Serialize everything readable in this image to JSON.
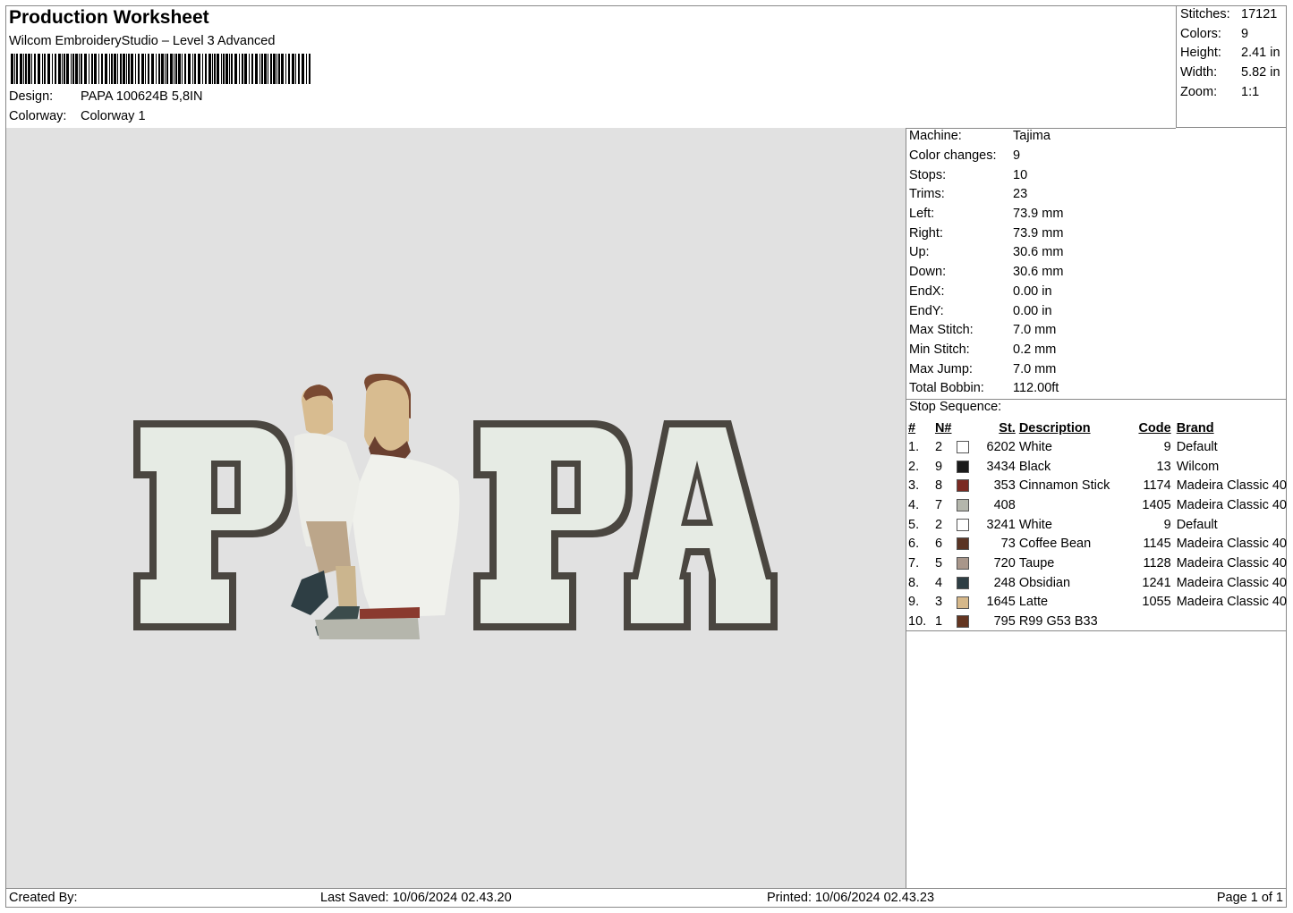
{
  "header": {
    "title": "Production Worksheet",
    "software": "Wilcom EmbroideryStudio – Level 3 Advanced",
    "design_label": "Design:",
    "design_value": "PAPA 100624B 5,8IN",
    "colorway_label": "Colorway:",
    "colorway_value": "Colorway 1"
  },
  "stats": [
    {
      "label": "Stitches:",
      "value": "17121"
    },
    {
      "label": "Colors:",
      "value": "9"
    },
    {
      "label": "Height:",
      "value": "2.41 in"
    },
    {
      "label": "Width:",
      "value": "5.82 in"
    },
    {
      "label": "Zoom:",
      "value": "1:1"
    }
  ],
  "machine_info": [
    {
      "label": "Machine:",
      "value": "Tajima"
    },
    {
      "label": "Color changes:",
      "value": "9"
    },
    {
      "label": "Stops:",
      "value": "10"
    },
    {
      "label": "Trims:",
      "value": "23"
    },
    {
      "label": "Left:",
      "value": "73.9 mm"
    },
    {
      "label": "Right:",
      "value": "73.9 mm"
    },
    {
      "label": "Up:",
      "value": "30.6 mm"
    },
    {
      "label": "Down:",
      "value": "30.6 mm"
    },
    {
      "label": "EndX:",
      "value": "0.00 in"
    },
    {
      "label": "EndY:",
      "value": "0.00 in"
    },
    {
      "label": "Max Stitch:",
      "value": "7.0 mm"
    },
    {
      "label": "Min Stitch:",
      "value": "0.2 mm"
    },
    {
      "label": "Max Jump:",
      "value": "7.0 mm"
    },
    {
      "label": "Total Bobbin:",
      "value": "112.00ft"
    }
  ],
  "stop_sequence": {
    "title": "Stop Sequence:",
    "columns": [
      "#",
      "N#",
      "St.",
      "Description",
      "Code",
      "Brand"
    ],
    "rows": [
      {
        "num": "1.",
        "n": "2",
        "color": "#ffffff",
        "st": "6202",
        "desc": "White",
        "code": "9",
        "brand": "Default"
      },
      {
        "num": "2.",
        "n": "9",
        "color": "#1a1a1a",
        "st": "3434",
        "desc": "Black",
        "code": "13",
        "brand": "Wilcom"
      },
      {
        "num": "3.",
        "n": "8",
        "color": "#7a2a22",
        "st": "353",
        "desc": "Cinnamon Stick",
        "code": "1174",
        "brand": "Madeira Classic 40"
      },
      {
        "num": "4.",
        "n": "7",
        "color": "#b4b6ac",
        "st": "408",
        "desc": "",
        "code": "1405",
        "brand": "Madeira Classic 40"
      },
      {
        "num": "5.",
        "n": "2",
        "color": "#ffffff",
        "st": "3241",
        "desc": "White",
        "code": "9",
        "brand": "Default"
      },
      {
        "num": "6.",
        "n": "6",
        "color": "#5a3424",
        "st": "73",
        "desc": "Coffee Bean",
        "code": "1145",
        "brand": "Madeira Classic 40"
      },
      {
        "num": "7.",
        "n": "5",
        "color": "#a8968a",
        "st": "720",
        "desc": "Taupe",
        "code": "1128",
        "brand": "Madeira Classic 40"
      },
      {
        "num": "8.",
        "n": "4",
        "color": "#2e3e44",
        "st": "248",
        "desc": "Obsidian",
        "code": "1241",
        "brand": "Madeira Classic 40"
      },
      {
        "num": "9.",
        "n": "3",
        "color": "#d6b88a",
        "st": "1645",
        "desc": "Latte",
        "code": "1055",
        "brand": "Madeira Classic 40"
      },
      {
        "num": "10.",
        "n": "1",
        "color": "#633521",
        "st": "795",
        "desc": "R99 G53 B33",
        "code": "",
        "brand": ""
      }
    ]
  },
  "design_preview": {
    "letters": [
      "P",
      "P",
      "A"
    ],
    "outline_color": "#4a4640",
    "fill_color": "#e6ebe4"
  },
  "footer": {
    "created_by": "Created By:",
    "last_saved": "Last Saved: 10/06/2024 02.43.20",
    "printed": "Printed: 10/06/2024 02.43.23",
    "page": "Page 1 of 1"
  }
}
